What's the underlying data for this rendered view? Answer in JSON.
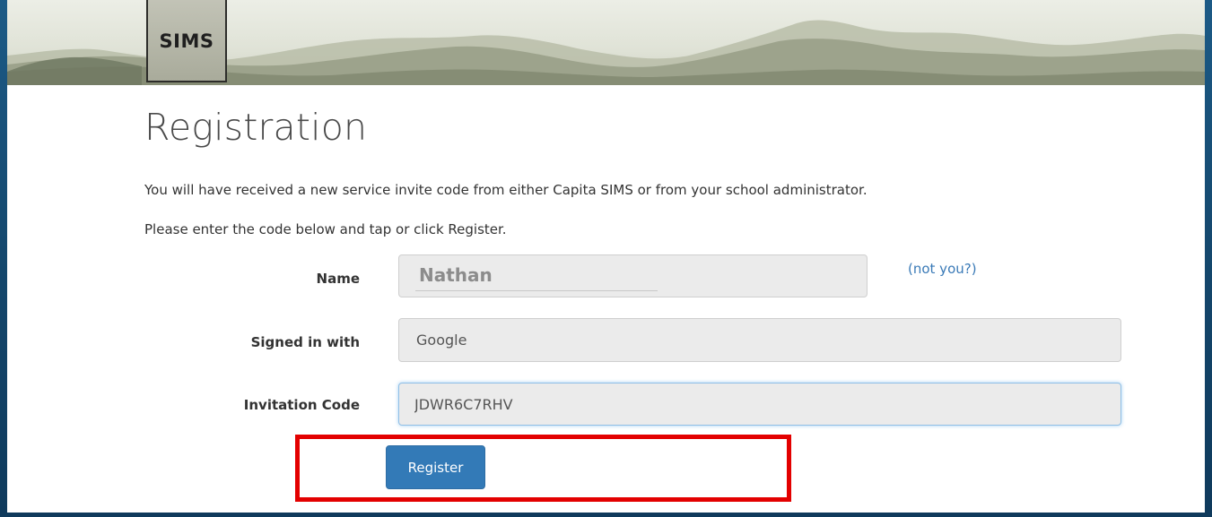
{
  "header": {
    "logo_text": "SIMS"
  },
  "page": {
    "title": "Registration",
    "intro_line1": "You will have received a new service invite code from either Capita SIMS or from your school administrator.",
    "intro_line2": "Please enter the code below and tap or click Register."
  },
  "form": {
    "name": {
      "label": "Name",
      "value": "Nathan",
      "not_you_link": "(not you?)"
    },
    "signed_in_with": {
      "label": "Signed in with",
      "value": "Google"
    },
    "invitation_code": {
      "label": "Invitation Code",
      "value": "JDWR6C7RHV"
    },
    "register_button": "Register"
  },
  "annotation": {
    "highlight_color": "#e30000",
    "highlight_target": "register-button"
  },
  "colors": {
    "primary_button": "#337ab7",
    "link": "#3a7ab7",
    "background_frame": "#14466b"
  }
}
